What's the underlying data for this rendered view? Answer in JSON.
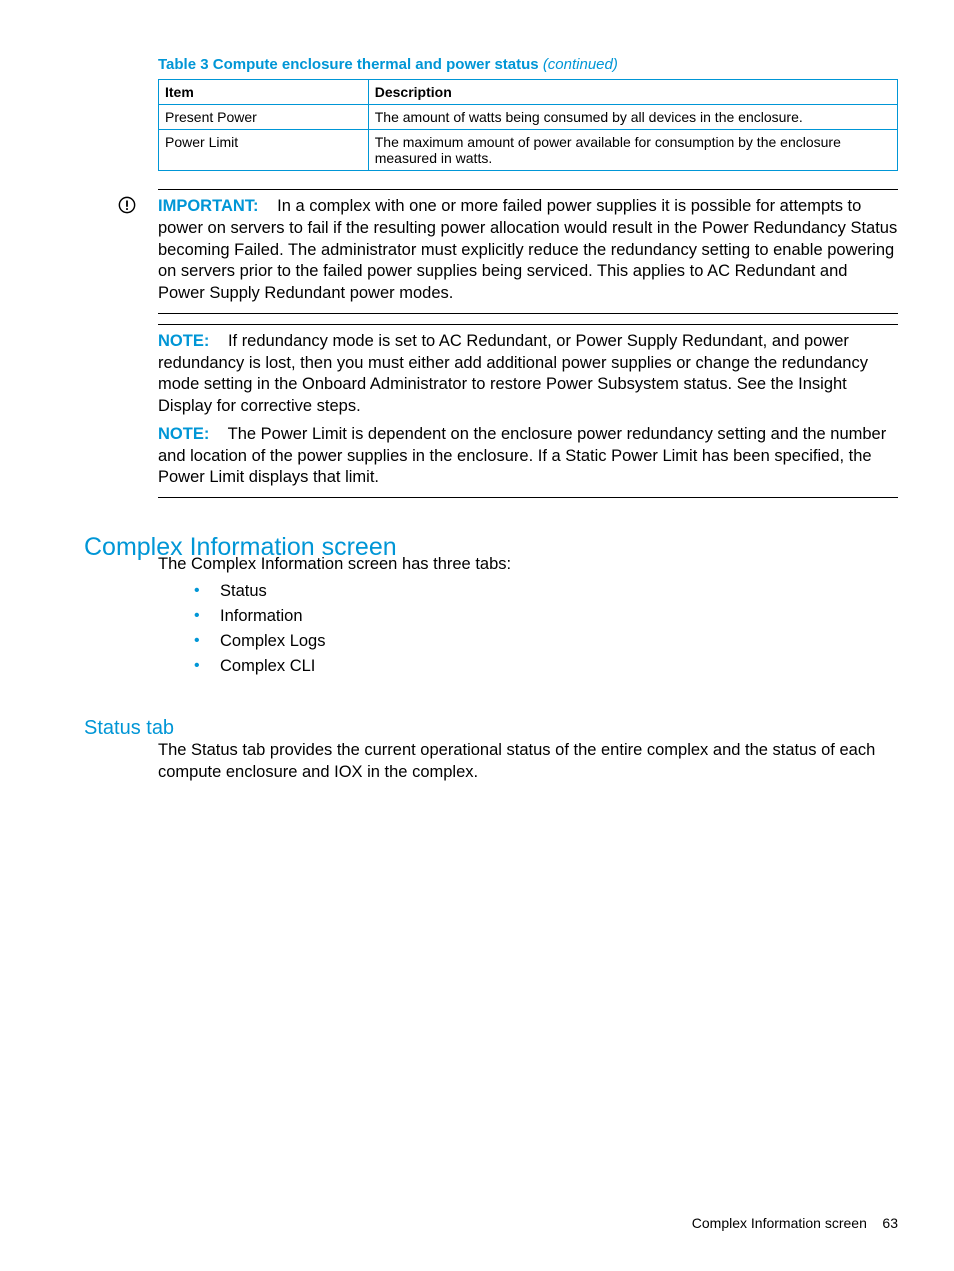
{
  "table": {
    "caption_main": "Table 3 Compute enclosure thermal and power status",
    "caption_cont": "(continued)",
    "headers": {
      "item": "Item",
      "desc": "Description"
    },
    "rows": [
      {
        "item": "Present Power",
        "desc": "The amount of watts being consumed by all devices in the enclosure."
      },
      {
        "item": "Power Limit",
        "desc": "The maximum amount of power available for consumption by the enclosure measured in watts."
      }
    ]
  },
  "important": {
    "label": "IMPORTANT:",
    "text": "In a complex with one or more failed power supplies it is possible for attempts to power on servers to fail if the resulting power allocation would result in the Power Redundancy Status becoming Failed. The administrator must explicitly reduce the redundancy setting to enable powering on servers prior to the failed power supplies being serviced. This applies to AC Redundant and Power Supply Redundant power modes."
  },
  "notes": {
    "label": "NOTE:",
    "n1": "If redundancy mode is set to AC Redundant, or Power Supply Redundant, and power redundancy is lost, then you must either add additional power supplies or change the redundancy mode setting in the Onboard Administrator to restore Power Subsystem status. See the Insight Display for corrective steps.",
    "n2": "The Power Limit is dependent on the enclosure power redundancy setting and the number and location of the power supplies in the enclosure. If a Static Power Limit has been specified, the Power Limit displays that limit."
  },
  "section": {
    "h2": "Complex Information screen",
    "intro": "The Complex Information screen has three tabs:",
    "bullets": [
      "Status",
      "Information",
      "Complex Logs",
      "Complex CLI"
    ],
    "h3": "Status tab",
    "status_text": "The Status tab provides the current operational status of the entire complex and the status of each compute enclosure and IOX in the complex."
  },
  "footer": {
    "title": "Complex Information screen",
    "page": "63"
  }
}
